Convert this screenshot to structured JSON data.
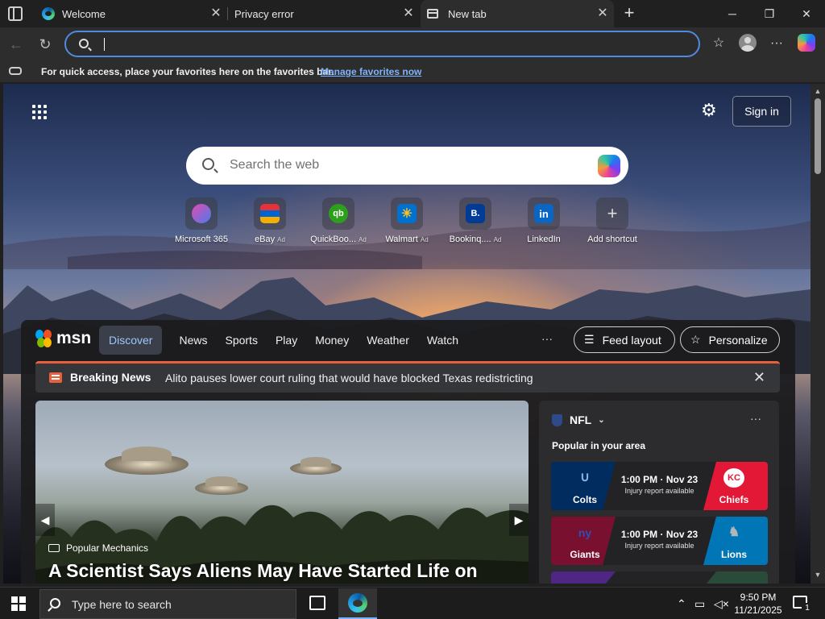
{
  "tabs": [
    {
      "title": "Welcome",
      "close": "✕"
    },
    {
      "title": "Privacy error",
      "close": "✕"
    },
    {
      "title": "New tab",
      "close": "✕",
      "active": true
    }
  ],
  "window_controls": {
    "minimize": "─",
    "restore": "❐",
    "close": "✕"
  },
  "address_bar": {
    "value": "",
    "placeholder": ""
  },
  "favorites_bar": {
    "text": "For quick access, place your favorites here on the favorites bar.",
    "link": "Manage favorites now"
  },
  "newtab": {
    "sign_in": "Sign in",
    "search_placeholder": "Search the web",
    "shortcuts": [
      {
        "label": "Microsoft 365",
        "ad": ""
      },
      {
        "label": "eBay",
        "ad": "Ad"
      },
      {
        "label": "QuickBoo...",
        "ad": "Ad"
      },
      {
        "label": "Walmart",
        "ad": "Ad"
      },
      {
        "label": "Bookinq....",
        "ad": "Ad"
      },
      {
        "label": "LinkedIn",
        "ad": ""
      },
      {
        "label": "Add shortcut",
        "ad": ""
      }
    ]
  },
  "feed": {
    "logo": "msn",
    "nav": [
      "Discover",
      "News",
      "Sports",
      "Play",
      "Money",
      "Weather",
      "Watch"
    ],
    "more": "···",
    "feed_layout": "Feed layout",
    "personalize": "Personalize",
    "breaking": {
      "title": "Breaking News",
      "text": "Alito pauses lower court ruling that would have blocked Texas redistricting"
    },
    "hero": {
      "source": "Popular Mechanics",
      "headline": "A Scientist Says Aliens May Have Started Life on"
    },
    "nfl": {
      "title": "NFL",
      "subtitle": "Popular in your area",
      "games": [
        {
          "home": "Colts",
          "away": "Chiefs",
          "time": "1:00 PM · Nov 23",
          "note": "Injury report available"
        },
        {
          "home": "Giants",
          "away": "Lions",
          "time": "1:00 PM · Nov 23",
          "note": "Injury report available"
        }
      ]
    }
  },
  "taskbar": {
    "search_placeholder": "Type here to search",
    "time": "9:50 PM",
    "date": "11/21/2025",
    "notifications": "1"
  },
  "colors": {
    "accent": "#4f8be0",
    "breaking": "#e8603c",
    "discover_text": "#9cc7ff"
  }
}
